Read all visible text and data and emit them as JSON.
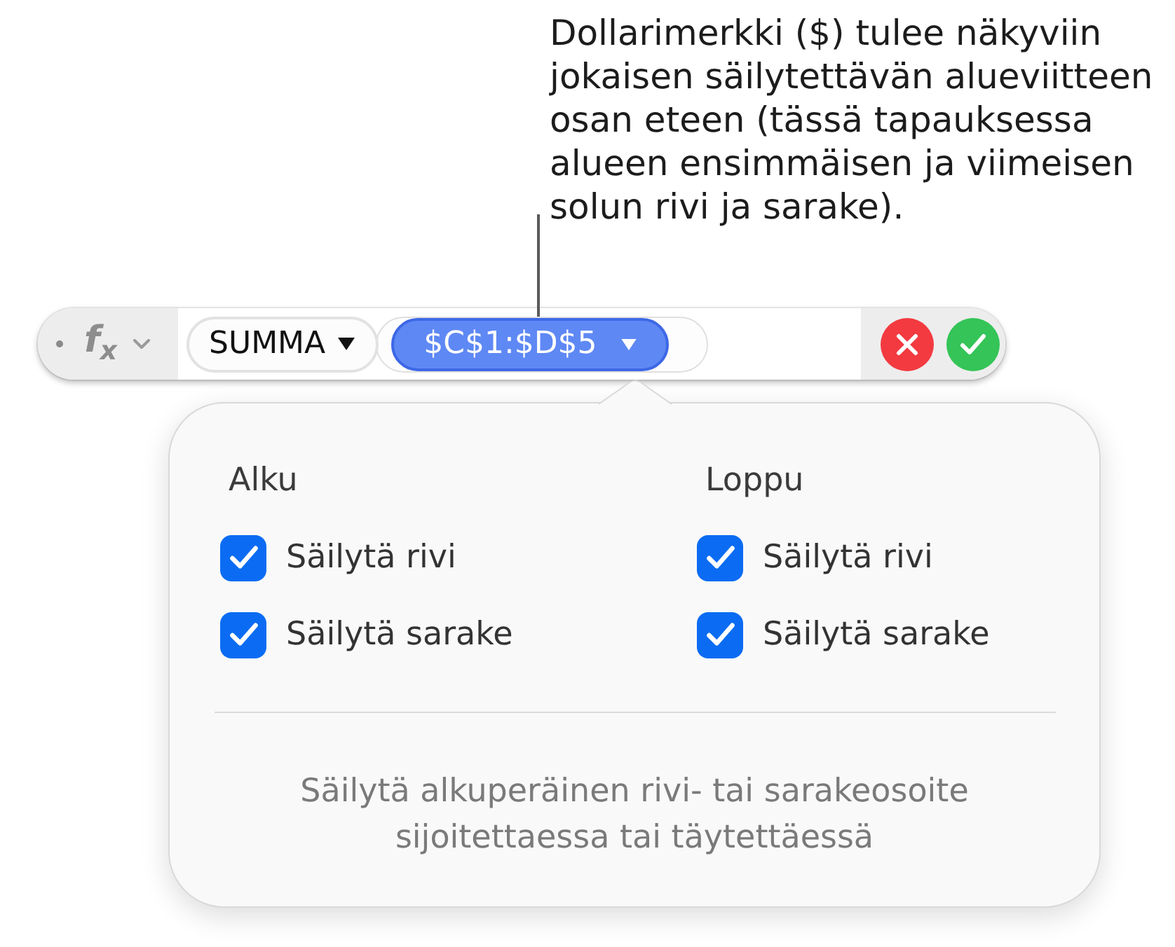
{
  "callout": {
    "lines": [
      "Dollarimerkki ($) tulee näkyviin",
      "jokaisen säilytettävän alueviitteen",
      "osan eteen (tässä tapauksessa",
      "alueen ensimmäisen ja viimeisen",
      "solun rivi ja sarake)."
    ]
  },
  "formula_bar": {
    "menu_label": "f$_{x}$",
    "function": {
      "text": "SUMMA",
      "selected": false
    },
    "arguments": [
      {
        "text": "$C$1:$D$5",
        "selected": true
      }
    ]
  },
  "popover": {
    "columns": [
      {
        "heading": "Alku",
        "items": [
          {
            "label": "Säilytä rivi",
            "checked": true
          },
          {
            "label": "Säilytä sarake",
            "checked": true
          }
        ]
      },
      {
        "heading": "Loppu",
        "items": [
          {
            "label": "Säilytä rivi",
            "checked": true
          },
          {
            "label": "Säilytä sarake",
            "checked": true
          }
        ]
      }
    ],
    "note_lines": [
      "Säilytä alkuperäinen rivi- tai sarakeosoite",
      "sijoitettaessa tai täytettäessä"
    ]
  }
}
